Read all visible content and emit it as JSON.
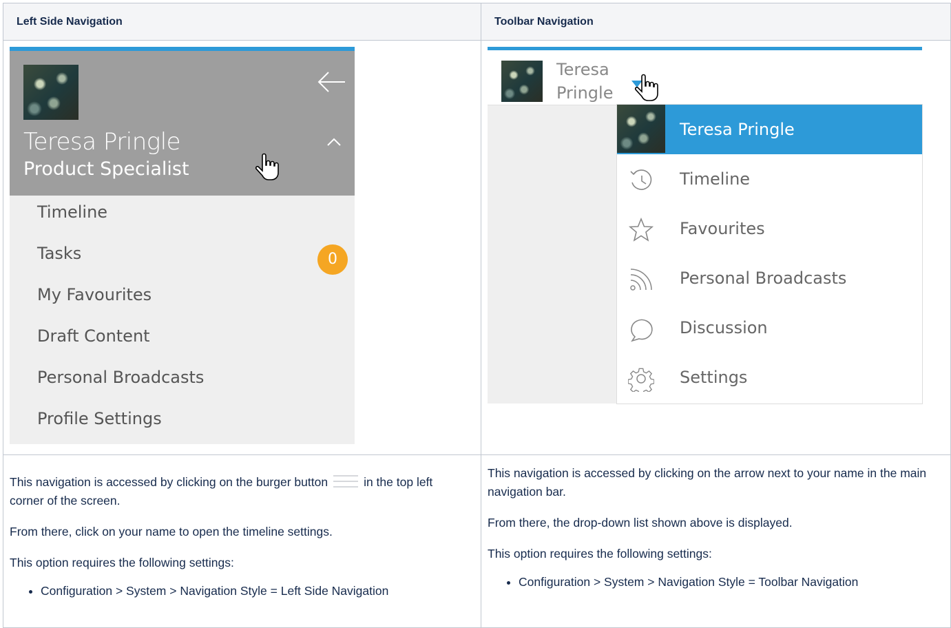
{
  "headers": {
    "left": "Left Side Navigation",
    "right": "Toolbar Navigation"
  },
  "left_nav": {
    "user_name": "Teresa Pringle",
    "user_role": "Product Specialist",
    "items": [
      {
        "label": "Timeline"
      },
      {
        "label": "Tasks",
        "badge": "0"
      },
      {
        "label": "My Favourites"
      },
      {
        "label": "Draft Content"
      },
      {
        "label": "Personal Broadcasts"
      },
      {
        "label": "Profile Settings"
      }
    ],
    "accent_color": "#2d9ad8",
    "badge_color": "#f5a623"
  },
  "toolbar_nav": {
    "first_name": "Teresa",
    "last_name": "Pringle",
    "menu": [
      {
        "label": "Teresa Pringle",
        "icon": "avatar"
      },
      {
        "label": "Timeline",
        "icon": "history-icon"
      },
      {
        "label": "Favourites",
        "icon": "star-icon"
      },
      {
        "label": "Personal Broadcasts",
        "icon": "rss-icon"
      },
      {
        "label": "Discussion",
        "icon": "speech-bubble-icon"
      },
      {
        "label": "Settings",
        "icon": "gear-icon"
      }
    ]
  },
  "left_text": {
    "p1_before": "This navigation is accessed by clicking on the burger button",
    "p1_after": "in the top left corner of the screen.",
    "p2": "From there, click on your name to open the timeline settings.",
    "p3": "This option requires the following settings:",
    "req": "Configuration > System > Navigation Style = Left Side Navigation"
  },
  "right_text": {
    "p1": "This navigation is accessed by clicking on the arrow next to your name in the main navigation bar.",
    "p2": "From there, the drop-down list shown above is displayed.",
    "p3": "This option requires the following settings:",
    "req": "Configuration > System > Navigation Style = Toolbar Navigation"
  }
}
